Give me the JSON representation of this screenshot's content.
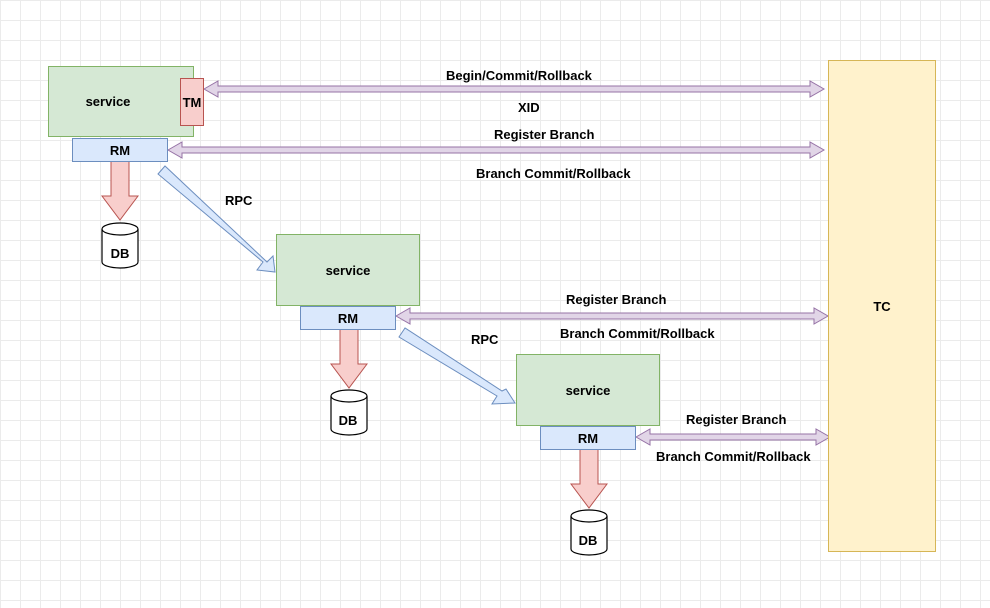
{
  "tc": {
    "label": "TC"
  },
  "tm": {
    "label": "TM"
  },
  "services": [
    {
      "label": "service",
      "rm": "RM",
      "db": "DB"
    },
    {
      "label": "service",
      "rm": "RM",
      "db": "DB"
    },
    {
      "label": "service",
      "rm": "RM",
      "db": "DB"
    }
  ],
  "labels": {
    "begin_commit_rollback": "Begin/Commit/Rollback",
    "xid": "XID",
    "register_branch_1": "Register Branch",
    "branch_commit_rollback_1": "Branch Commit/Rollback",
    "rpc_1": "RPC",
    "register_branch_2": "Register Branch",
    "branch_commit_rollback_2": "Branch Commit/Rollback",
    "rpc_2": "RPC",
    "register_branch_3": "Register Branch",
    "branch_commit_rollback_3": "Branch Commit/Rollback"
  },
  "colors": {
    "service_fill": "#d5e8d4",
    "rm_fill": "#dae8fc",
    "tm_fill": "#f8cecc",
    "tc_fill": "#fff2cc",
    "bidirectional_arrow": "#e1d5e7",
    "rpc_arrow": "#dae8fc",
    "db_arrow": "#f8cecc"
  }
}
